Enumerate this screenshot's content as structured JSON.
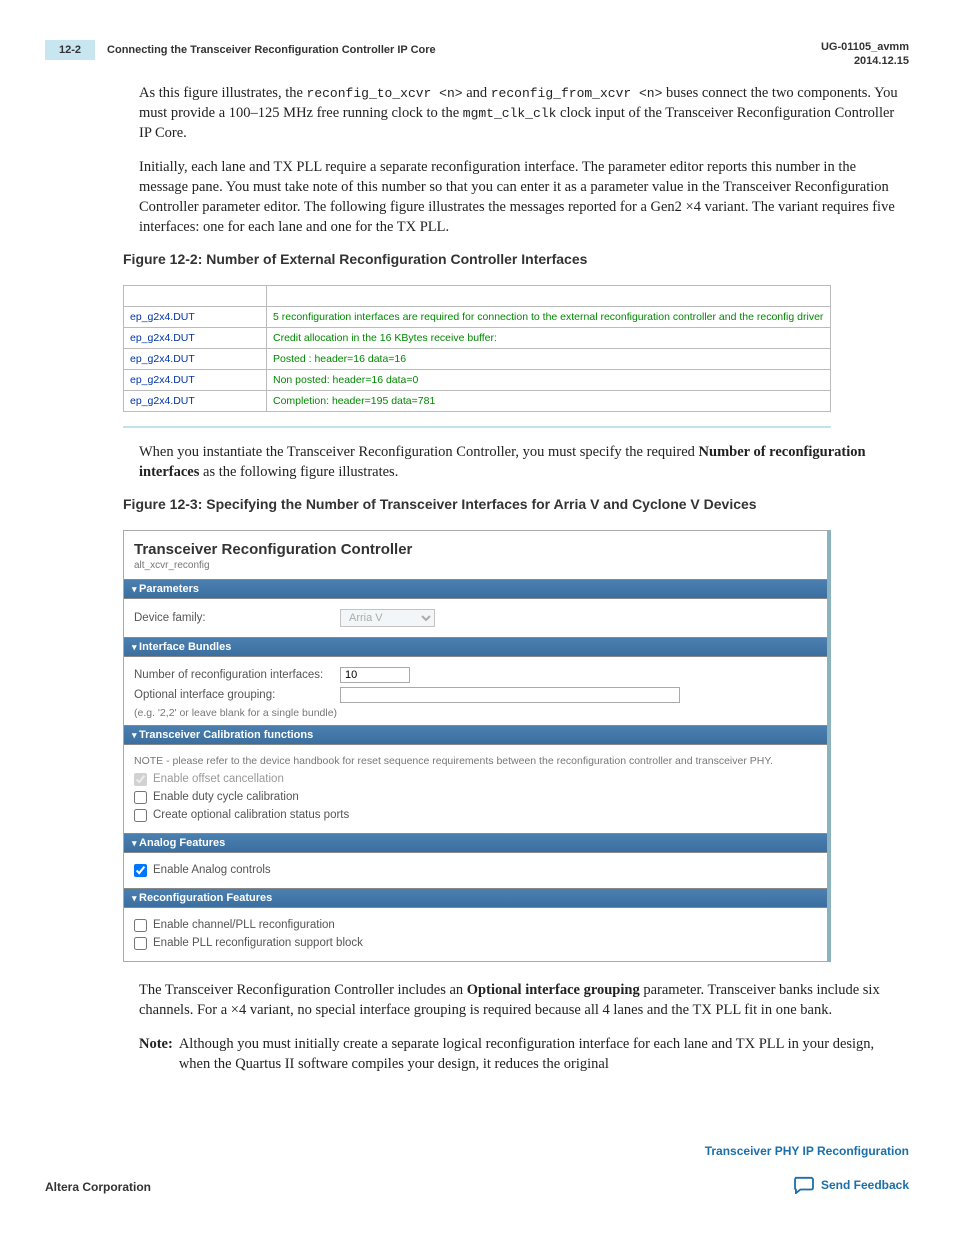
{
  "header": {
    "page_number": "12-2",
    "section_title": "Connecting the Transceiver Reconfiguration Controller IP Core",
    "doc_id": "UG-01105_avmm",
    "date": "2014.12.15"
  },
  "p1_a": "As this figure illustrates, the ",
  "p1_code_a": "reconfig_to_xcvr ",
  "p1_n1": "<n>",
  "p1_b": " and ",
  "p1_code_b": "reconfig_from_xcvr ",
  "p1_n2": "<n>",
  "p1_c": " buses connect the two components. You must provide a 100–125 MHz free  running clock to the ",
  "p1_code_c": "mgmt_clk_clk",
  "p1_d": " clock input of the Transceiver Reconfiguration Controller IP Core.",
  "p2": "Initially, each lane and TX PLL require a separate reconfiguration interface. The parameter editor reports this number in the message pane. You must take note of this number so that you can enter it as a parameter value in the Transceiver Reconfiguration Controller parameter editor. The following figure illustrates the messages reported for a Gen2 ×4 variant. The variant requires five interfaces: one for each lane and one for the TX PLL.",
  "fig12_2_caption": "Figure 12-2: Number of External Reconfiguration Controller Interfaces",
  "fig12_2": {
    "rows": [
      {
        "left": "ep_g2x4.DUT",
        "right": "5 reconfiguration interfaces are required for connection to the external reconfiguration controller and the reconfig driver"
      },
      {
        "left": "ep_g2x4.DUT",
        "right": "Credit allocation in the 16 KBytes receive buffer:"
      },
      {
        "left": "ep_g2x4.DUT",
        "right": "Posted : header=16 data=16"
      },
      {
        "left": "ep_g2x4.DUT",
        "right": "Non posted: header=16 data=0"
      },
      {
        "left": "ep_g2x4.DUT",
        "right": "Completion: header=195 data=781"
      }
    ]
  },
  "p3_a": "When you instantiate the Transceiver Reconfiguration Controller, you must specify the required ",
  "p3_b": "Number of reconfiguration interfaces",
  "p3_c": " as the following figure illustrates.",
  "fig12_3_caption": "Figure 12-3: Specifying the Number of Transceiver Interfaces for Arria V and Cyclone V Devices",
  "panel": {
    "title": "Transceiver Reconfiguration Controller",
    "subtitle": "alt_xcvr_reconfig",
    "sections": {
      "parameters": {
        "header": "Parameters",
        "device_family_label": "Device family:",
        "device_family_value": "Arria V"
      },
      "interface_bundles": {
        "header": "Interface Bundles",
        "num_reconfig_label": "Number of reconfiguration interfaces:",
        "num_reconfig_value": "10",
        "optional_grouping_label": "Optional interface grouping:",
        "optional_grouping_value": "",
        "hint": "(e.g. '2,2' or leave blank for a single bundle)"
      },
      "calibration": {
        "header": "Transceiver Calibration functions",
        "note": "NOTE - please refer to the device handbook for reset sequence requirements between the reconfiguration controller and transceiver PHY.",
        "enable_offset": "Enable offset cancellation",
        "enable_duty": "Enable duty cycle calibration",
        "create_status": "Create optional calibration status ports"
      },
      "analog": {
        "header": "Analog Features",
        "enable_analog": "Enable Analog controls"
      },
      "reconfig": {
        "header": "Reconfiguration Features",
        "enable_channel": "Enable channel/PLL reconfiguration",
        "enable_pll": "Enable PLL reconfiguration support block"
      }
    }
  },
  "p4_a": "The Transceiver Reconfiguration Controller includes an ",
  "p4_b": "Optional interface grouping",
  "p4_c": " parameter. Transceiver banks include six channels. For a ×4 variant, no special interface grouping is required because all 4 lanes and the TX PLL fit in one bank.",
  "note": {
    "label": "Note:",
    "text": "Although you must initially create a separate logical reconfiguration interface for each lane and TX PLL in your design, when the Quartus II software compiles your design, it reduces the original"
  },
  "footer": {
    "left": "Altera Corporation",
    "right_link": "Transceiver PHY IP Reconfiguration",
    "feedback": "Send Feedback"
  }
}
